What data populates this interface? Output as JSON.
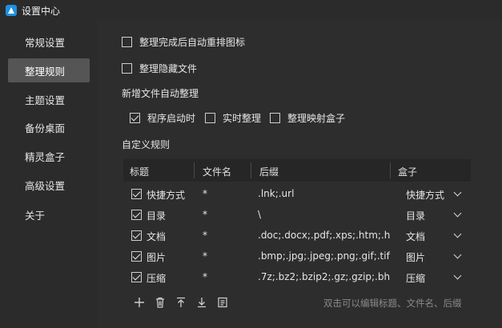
{
  "window": {
    "title": "设置中心"
  },
  "sidebar": {
    "items": [
      {
        "label": "常规设置"
      },
      {
        "label": "整理规则"
      },
      {
        "label": "主题设置"
      },
      {
        "label": "备份桌面"
      },
      {
        "label": "精灵盒子"
      },
      {
        "label": "高级设置"
      },
      {
        "label": "关于"
      }
    ],
    "active_index": 1
  },
  "options": {
    "auto_rearrange": {
      "label": "整理完成后自动重排图标",
      "checked": false
    },
    "hide_files": {
      "label": "整理隐藏文件",
      "checked": false
    }
  },
  "auto_organize": {
    "heading": "新增文件自动整理",
    "startup": {
      "label": "程序启动时",
      "checked": true
    },
    "realtime": {
      "label": "实时整理",
      "checked": false
    },
    "mapped_box": {
      "label": "整理映射盒子",
      "checked": false
    }
  },
  "rules": {
    "heading": "自定义规则",
    "columns": {
      "title": "标题",
      "filename": "文件名",
      "suffix": "后缀",
      "box": "盒子"
    },
    "rows": [
      {
        "checked": true,
        "title": "快捷方式",
        "filename": "*",
        "suffix": ".lnk;.url",
        "box": "快捷方式"
      },
      {
        "checked": true,
        "title": "目录",
        "filename": "*",
        "suffix": "\\",
        "box": "目录"
      },
      {
        "checked": true,
        "title": "文档",
        "filename": "*",
        "suffix": ".doc;.docx;.pdf;.xps;.htm;.h…",
        "box": "文档"
      },
      {
        "checked": true,
        "title": "图片",
        "filename": "*",
        "suffix": ".bmp;.jpg;.jpeg;.png;.gif;.tif…",
        "box": "图片"
      },
      {
        "checked": true,
        "title": "压缩",
        "filename": "*",
        "suffix": ".7z;.bz2;.bzip2;.gz;.gzip;.bh…",
        "box": "压缩"
      }
    ],
    "hint": "双击可以编辑标题、文件名、后缀"
  },
  "toolbar": {
    "icons": [
      "add-icon",
      "trash-icon",
      "move-top-icon",
      "move-bottom-icon",
      "document-icon"
    ]
  },
  "colors": {
    "background": "#2b2b2b",
    "sidebar_active": "#555555",
    "table_header": "#262626",
    "app_icon": "#1e90e0"
  }
}
